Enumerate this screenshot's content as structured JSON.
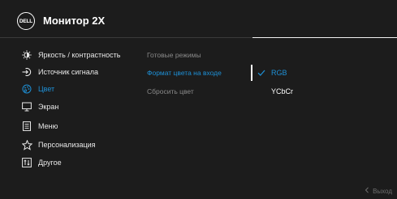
{
  "header": {
    "brand": "DELL",
    "title": "Монитор 2X"
  },
  "menu": {
    "items": [
      {
        "label": "Яркость / контрастность",
        "icon": "brightness-icon",
        "active": false
      },
      {
        "label": "Источник сигнала",
        "icon": "input-source-icon",
        "active": false
      },
      {
        "label": "Цвет",
        "icon": "color-palette-icon",
        "active": true
      },
      {
        "label": "Экран",
        "icon": "display-icon",
        "active": false
      },
      {
        "label": "Меню",
        "icon": "menu-icon",
        "active": false
      },
      {
        "label": "Персонализация",
        "icon": "star-icon",
        "active": false
      },
      {
        "label": "Другое",
        "icon": "other-icon",
        "active": false
      }
    ]
  },
  "submenu": {
    "items": [
      {
        "label": "Готовые режимы",
        "active": false
      },
      {
        "label": "Формат цвета на входе",
        "active": true
      },
      {
        "label": "Сбросить цвет",
        "active": false
      }
    ]
  },
  "options": {
    "items": [
      {
        "label": "RGB",
        "selected": true
      },
      {
        "label": "YCbCr",
        "selected": false
      }
    ]
  },
  "footer": {
    "exit_label": "Выход",
    "exit_icon": "chevron-left-icon"
  },
  "colors": {
    "accent": "#1e90d6",
    "background": "#1c1c1c",
    "text": "#e8e8e8",
    "muted": "#8a8a8a"
  }
}
